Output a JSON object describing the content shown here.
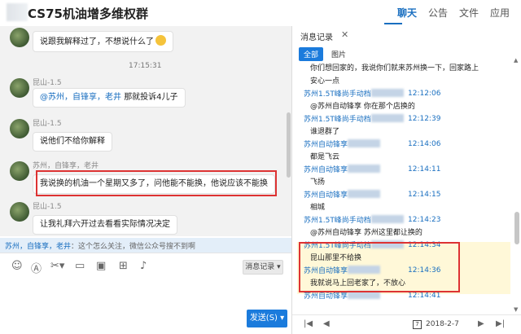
{
  "window": {
    "title": "CS75机油增多维权群",
    "nav": [
      "聊天",
      "公告",
      "文件",
      "应用"
    ]
  },
  "chat": {
    "messages": [
      {
        "text": "说跟我解释过了，不想说什么了"
      },
      {
        "sender": "昆山-1.5",
        "at": "@苏州，自锋享，老井",
        "text": "那就投诉4儿子"
      },
      {
        "sender": "昆山-1.5",
        "text": "说他们不给你解释"
      },
      {
        "sender": "苏州，自锋享，老井",
        "text": "我说换的机油一个星期又多了，问他能不能换，他说应该不能换"
      },
      {
        "sender": "昆山-1.5",
        "text": "让我礼拜六开过去看看实际情况决定"
      }
    ],
    "time": "17:15:31",
    "notice": {
      "at": "苏州，自锋享，老井",
      "text": "：这个怎么关注，微信公众号搜不到啊"
    },
    "toolbar": {
      "icons": [
        "smiley-icon",
        "scissors-icon",
        "image-icon",
        "bag-icon",
        "mic-icon"
      ],
      "history": "消息记录",
      "send": "发送(S)"
    }
  },
  "history": {
    "header": "消息记录",
    "close": "✕",
    "filters": [
      "全部",
      "图片"
    ],
    "lines": [
      {
        "kind": "text",
        "text": "你们想回家的，我说你们就来苏州换一下，回家路上"
      },
      {
        "kind": "text",
        "text": "安心一点"
      },
      {
        "kind": "name",
        "name": "苏州1.5T峰尚手动档",
        "time": "12:12:06"
      },
      {
        "kind": "text",
        "text": "@苏州自动锋享 你在那个店换的"
      },
      {
        "kind": "name",
        "name": "苏州1.5T峰尚手动档",
        "time": "12:12:39"
      },
      {
        "kind": "text",
        "text": "谁退群了"
      },
      {
        "kind": "name",
        "name": "苏州自动锋享",
        "time": "12:14:06"
      },
      {
        "kind": "text",
        "text": "都是飞云"
      },
      {
        "kind": "name",
        "name": "苏州自动锋享",
        "time": "12:14:11"
      },
      {
        "kind": "text",
        "text": "飞扬"
      },
      {
        "kind": "name",
        "name": "苏州自动锋享",
        "time": "12:14:15"
      },
      {
        "kind": "text",
        "text": "相城"
      },
      {
        "kind": "name",
        "name": "苏州1.5T峰尚手动档",
        "time": "12:14:23"
      },
      {
        "kind": "text",
        "text": "@苏州自动锋享 苏州这里都让换的"
      },
      {
        "kind": "name",
        "name": "苏州1.5T峰尚手动档",
        "time": "12:14:34"
      },
      {
        "kind": "text",
        "text": "昆山那里不给换"
      },
      {
        "kind": "name",
        "name": "苏州自动锋享",
        "time": "12:14:36"
      },
      {
        "kind": "text",
        "text": "我就说马上回老家了，不放心"
      },
      {
        "kind": "name",
        "name": "苏州自动锋享",
        "time": "12:14:41"
      }
    ],
    "calendar_day": "7",
    "date": "2018-2-7"
  }
}
